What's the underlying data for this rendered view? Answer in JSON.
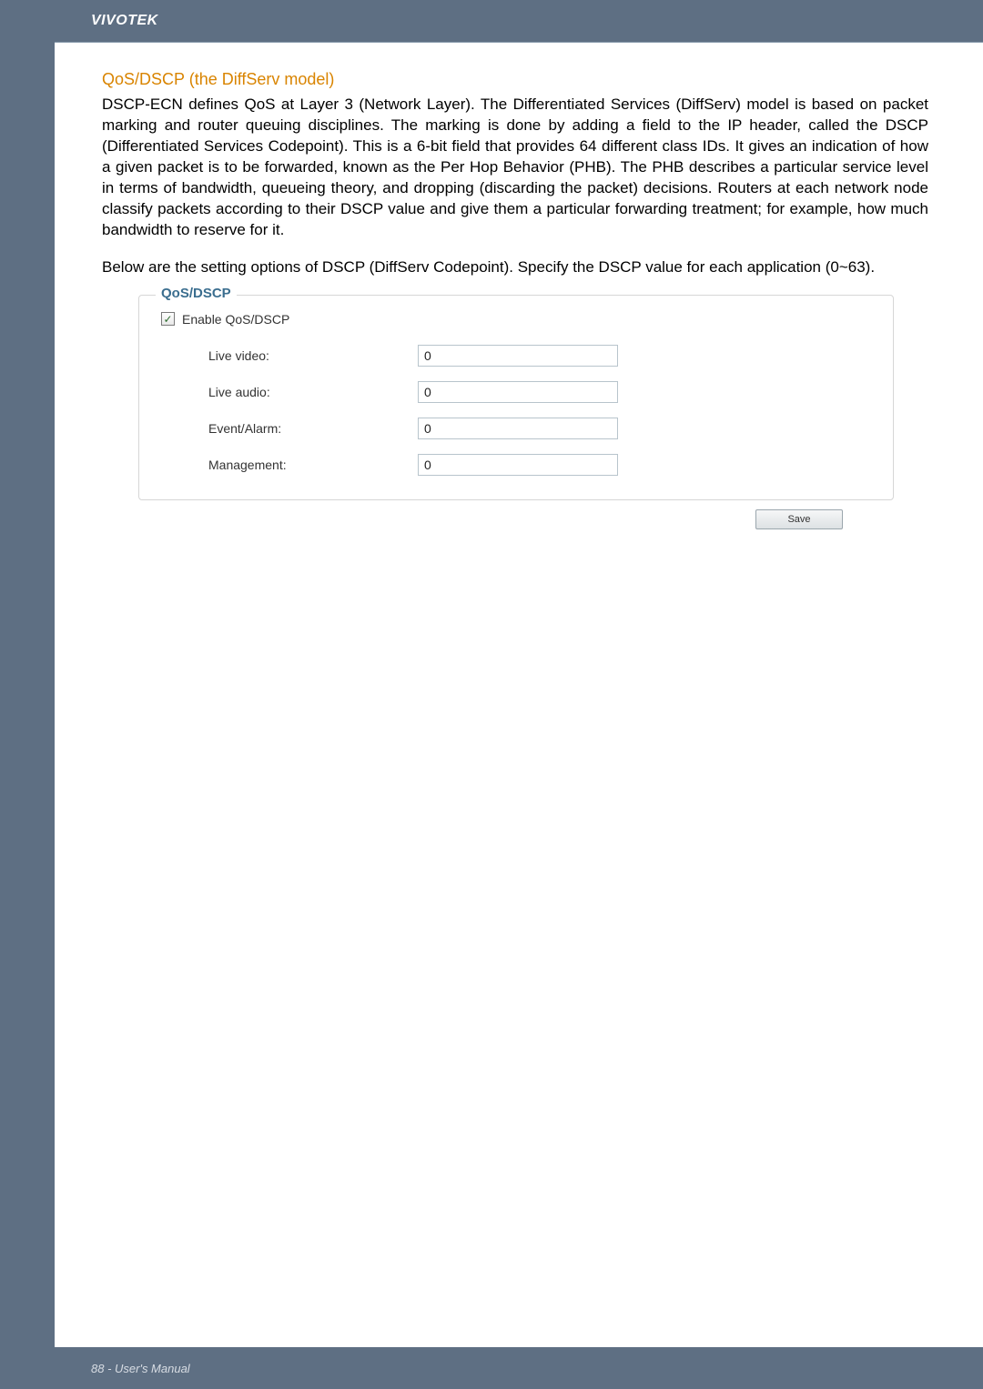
{
  "header": {
    "brand": "VIVOTEK"
  },
  "section": {
    "title": "QoS/DSCP (the DiffServ model)",
    "para1": "DSCP-ECN defines QoS at Layer 3 (Network Layer). The Differentiated Services (DiffServ) model is based on packet marking and router queuing disciplines. The marking is done by adding a field to the IP header, called the DSCP (Differentiated Services Codepoint). This is a 6-bit field that provides 64 different class IDs. It gives an indication of how a given packet is to be forwarded, known as the Per Hop Behavior (PHB). The PHB describes a particular service level in terms of bandwidth, queueing theory, and dropping (discarding the packet) decisions. Routers at each network node classify packets according to their DSCP value and give them a particular forwarding treatment; for example, how much bandwidth to reserve for it.",
    "para2": "Below are the setting options of DSCP (DiffServ Codepoint). Specify the DSCP value for each application (0~63)."
  },
  "form": {
    "legend": "QoS/DSCP",
    "enable_label": "Enable QoS/DSCP",
    "enable_checked": true,
    "rows": [
      {
        "label": "Live video:",
        "value": "0"
      },
      {
        "label": "Live audio:",
        "value": "0"
      },
      {
        "label": "Event/Alarm:",
        "value": "0"
      },
      {
        "label": "Management:",
        "value": "0"
      }
    ],
    "save_label": "Save"
  },
  "footer": {
    "text": "88 - User's Manual"
  }
}
